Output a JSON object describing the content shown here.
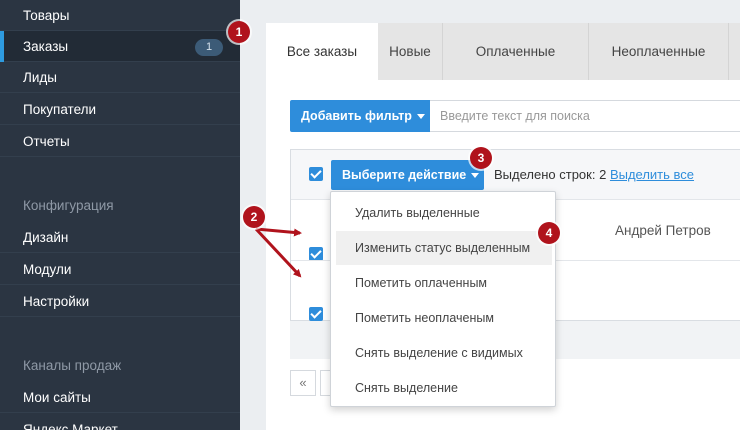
{
  "sidebar": {
    "items": [
      {
        "label": "Товары"
      },
      {
        "label": "Заказы",
        "badge": "1"
      },
      {
        "label": "Лиды"
      },
      {
        "label": "Покупатели"
      },
      {
        "label": "Отчеты"
      }
    ],
    "config_header": "Конфигурация",
    "config_items": [
      {
        "label": "Дизайн"
      },
      {
        "label": "Модули"
      },
      {
        "label": "Настройки"
      }
    ],
    "channels_header": "Каналы продаж",
    "channel_items": [
      {
        "label": "Мои сайты"
      },
      {
        "label": "Яндекс.Маркет"
      }
    ]
  },
  "tabs": [
    {
      "label": "Все заказы"
    },
    {
      "label": "Новые"
    },
    {
      "label": "Оплаченные"
    },
    {
      "label": "Неоплаченные"
    }
  ],
  "filter": {
    "button_label": "Добавить фильтр",
    "search_placeholder": "Введите текст для поиска"
  },
  "actions": {
    "button_label": "Выберите действие",
    "selected_label": "Выделено строк:",
    "selected_count": "2",
    "select_all_link": "Выделить все"
  },
  "rows": [
    {
      "name": "Андрей Петров"
    }
  ],
  "dropdown": {
    "items": [
      {
        "label": "Удалить выделенные"
      },
      {
        "label": "Изменить статус выделенным"
      },
      {
        "label": "Пометить оплаченным"
      },
      {
        "label": "Пометить неоплаченым"
      },
      {
        "label": "Снять выделение с видимых"
      },
      {
        "label": "Снять выделение"
      }
    ]
  },
  "pager": {
    "first": "«",
    "prev": "‹"
  },
  "annotations": {
    "marker_1": "1",
    "marker_2": "2",
    "marker_3": "3",
    "marker_4": "4",
    "color": "#b0131c"
  },
  "colors": {
    "sidebar_bg": "#2b3542",
    "accent": "#2e8ddb",
    "active_indicator": "#2e9be0"
  }
}
